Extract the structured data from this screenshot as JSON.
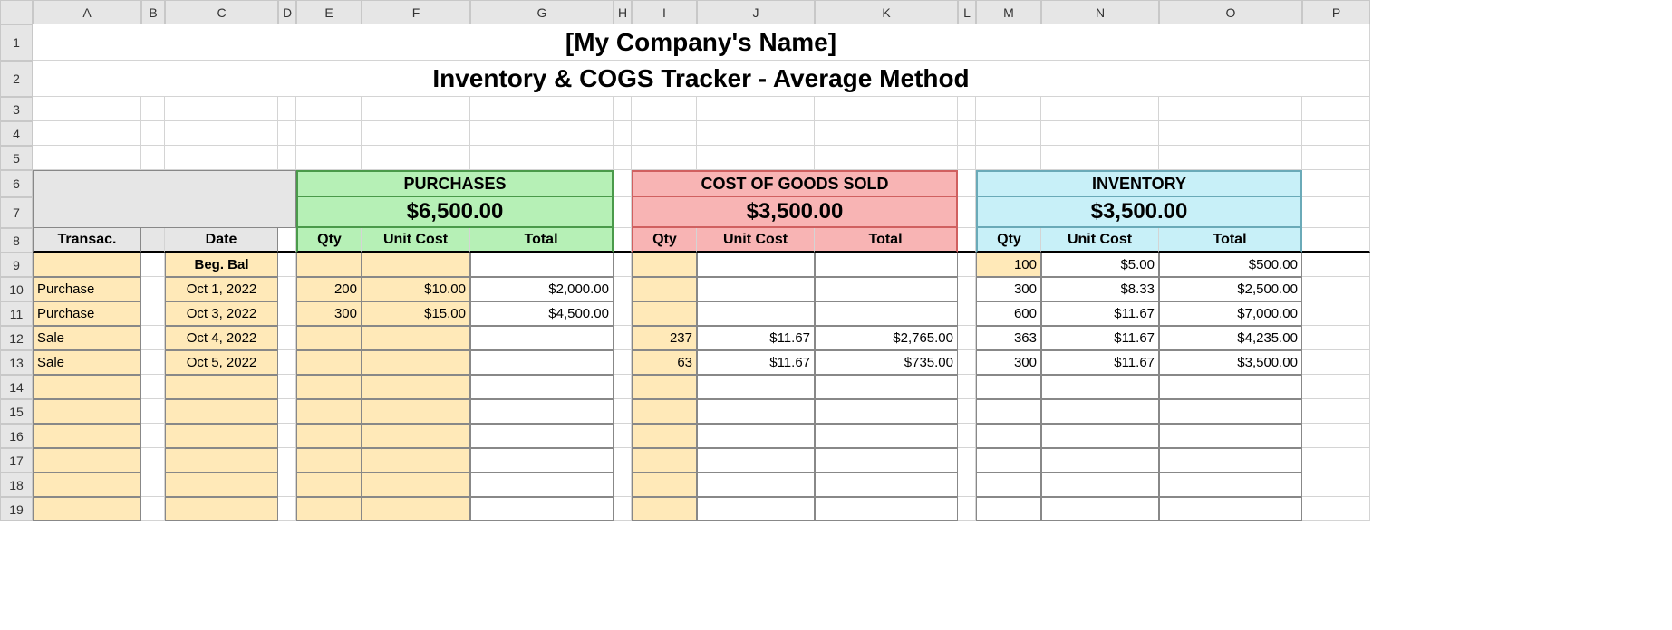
{
  "columns": [
    "A",
    "B",
    "C",
    "D",
    "E",
    "F",
    "G",
    "H",
    "I",
    "J",
    "K",
    "L",
    "M",
    "N",
    "O",
    "P"
  ],
  "rowCount": 19,
  "title1": "[My Company's Name]",
  "title2": "Inventory & COGS Tracker - Average Method",
  "labels": {
    "transac": "Transac.",
    "date": "Date",
    "qty": "Qty",
    "unitCost": "Unit Cost",
    "total": "Total",
    "begBal": "Beg. Bal"
  },
  "sections": {
    "purchases": {
      "label": "PURCHASES",
      "total": "$6,500.00"
    },
    "cogs": {
      "label": "COST OF GOODS SOLD",
      "total": "$3,500.00"
    },
    "inventory": {
      "label": "INVENTORY",
      "total": "$3,500.00"
    }
  },
  "rows": [
    {
      "transac": "",
      "date": "Beg. Bal",
      "p_qty": "",
      "p_uc": "",
      "p_tot": "",
      "c_qty": "",
      "c_uc": "",
      "c_tot": "",
      "i_qty": "100",
      "i_uc": "$5.00",
      "i_tot": "$500.00"
    },
    {
      "transac": "Purchase",
      "date": "Oct 1, 2022",
      "p_qty": "200",
      "p_uc": "$10.00",
      "p_tot": "$2,000.00",
      "c_qty": "",
      "c_uc": "",
      "c_tot": "",
      "i_qty": "300",
      "i_uc": "$8.33",
      "i_tot": "$2,500.00"
    },
    {
      "transac": "Purchase",
      "date": "Oct 3, 2022",
      "p_qty": "300",
      "p_uc": "$15.00",
      "p_tot": "$4,500.00",
      "c_qty": "",
      "c_uc": "",
      "c_tot": "",
      "i_qty": "600",
      "i_uc": "$11.67",
      "i_tot": "$7,000.00"
    },
    {
      "transac": "Sale",
      "date": "Oct 4, 2022",
      "p_qty": "",
      "p_uc": "",
      "p_tot": "",
      "c_qty": "237",
      "c_uc": "$11.67",
      "c_tot": "$2,765.00",
      "i_qty": "363",
      "i_uc": "$11.67",
      "i_tot": "$4,235.00"
    },
    {
      "transac": "Sale",
      "date": "Oct 5, 2022",
      "p_qty": "",
      "p_uc": "",
      "p_tot": "",
      "c_qty": "63",
      "c_uc": "$11.67",
      "c_tot": "$735.00",
      "i_qty": "300",
      "i_uc": "$11.67",
      "i_tot": "$3,500.00"
    },
    {
      "transac": "",
      "date": "",
      "p_qty": "",
      "p_uc": "",
      "p_tot": "",
      "c_qty": "",
      "c_uc": "",
      "c_tot": "",
      "i_qty": "",
      "i_uc": "",
      "i_tot": ""
    },
    {
      "transac": "",
      "date": "",
      "p_qty": "",
      "p_uc": "",
      "p_tot": "",
      "c_qty": "",
      "c_uc": "",
      "c_tot": "",
      "i_qty": "",
      "i_uc": "",
      "i_tot": ""
    },
    {
      "transac": "",
      "date": "",
      "p_qty": "",
      "p_uc": "",
      "p_tot": "",
      "c_qty": "",
      "c_uc": "",
      "c_tot": "",
      "i_qty": "",
      "i_uc": "",
      "i_tot": ""
    },
    {
      "transac": "",
      "date": "",
      "p_qty": "",
      "p_uc": "",
      "p_tot": "",
      "c_qty": "",
      "c_uc": "",
      "c_tot": "",
      "i_qty": "",
      "i_uc": "",
      "i_tot": ""
    },
    {
      "transac": "",
      "date": "",
      "p_qty": "",
      "p_uc": "",
      "p_tot": "",
      "c_qty": "",
      "c_uc": "",
      "c_tot": "",
      "i_qty": "",
      "i_uc": "",
      "i_tot": ""
    },
    {
      "transac": "",
      "date": "",
      "p_qty": "",
      "p_uc": "",
      "p_tot": "",
      "c_qty": "",
      "c_uc": "",
      "c_tot": "",
      "i_qty": "",
      "i_uc": "",
      "i_tot": ""
    }
  ],
  "chart_data": {
    "type": "table",
    "title": "Inventory & COGS Tracker - Average Method",
    "summary": {
      "purchases_total": 6500.0,
      "cogs_total": 3500.0,
      "inventory_total": 3500.0
    },
    "columns": [
      "Transac.",
      "Date",
      "Purch Qty",
      "Purch Unit Cost",
      "Purch Total",
      "COGS Qty",
      "COGS Unit Cost",
      "COGS Total",
      "Inv Qty",
      "Inv Unit Cost",
      "Inv Total"
    ],
    "records": [
      [
        "",
        "Beg. Bal",
        null,
        null,
        null,
        null,
        null,
        null,
        100,
        5.0,
        500.0
      ],
      [
        "Purchase",
        "Oct 1, 2022",
        200,
        10.0,
        2000.0,
        null,
        null,
        null,
        300,
        8.33,
        2500.0
      ],
      [
        "Purchase",
        "Oct 3, 2022",
        300,
        15.0,
        4500.0,
        null,
        null,
        null,
        600,
        11.67,
        7000.0
      ],
      [
        "Sale",
        "Oct 4, 2022",
        null,
        null,
        null,
        237,
        11.67,
        2765.0,
        363,
        11.67,
        4235.0
      ],
      [
        "Sale",
        "Oct 5, 2022",
        null,
        null,
        null,
        63,
        11.67,
        735.0,
        300,
        11.67,
        3500.0
      ]
    ]
  }
}
